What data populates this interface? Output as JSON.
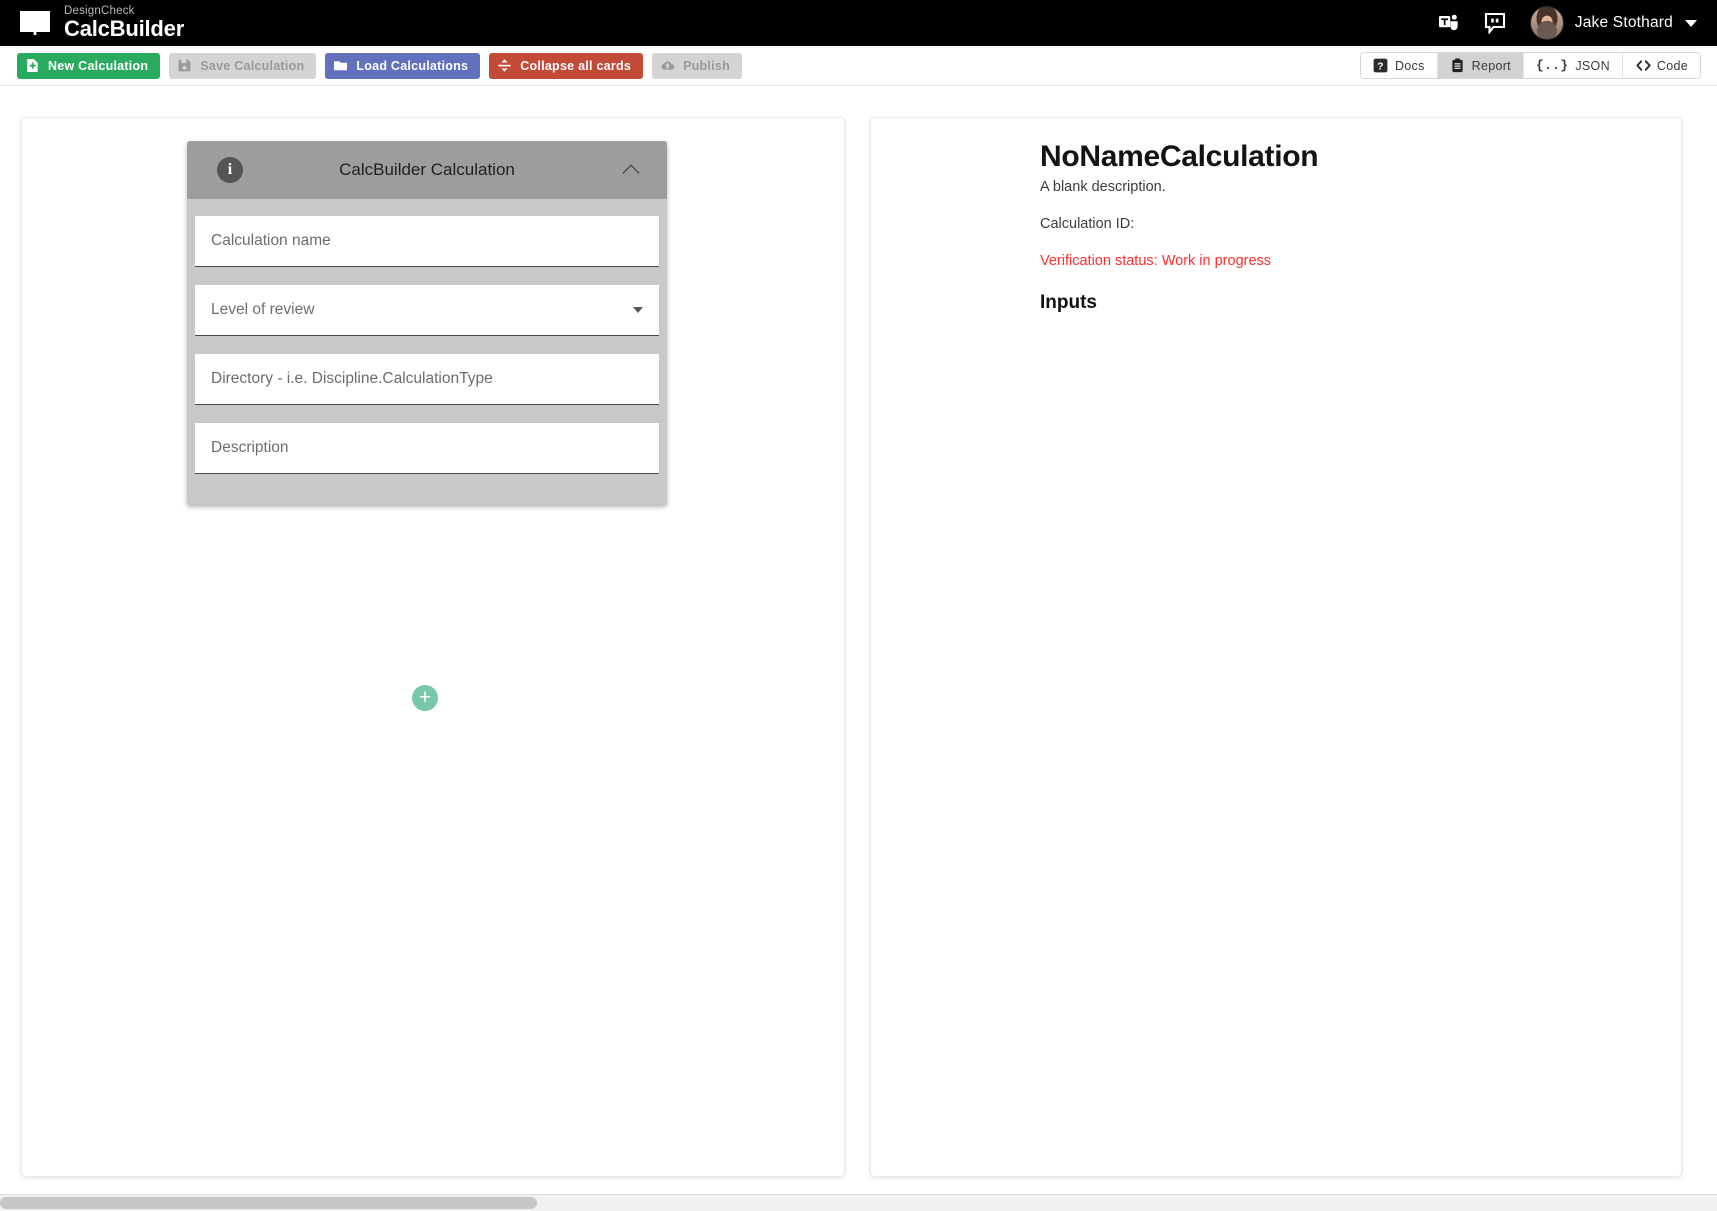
{
  "topbar": {
    "brand_sub": "DesignCheck",
    "brand_main": "CalcBuilder",
    "book_icon": "open-book-icon",
    "teams_icon": "microsoft-teams-icon",
    "feedback_icon": "feedback-quote-icon",
    "avatar": "user-avatar",
    "user_name": "Jake Stothard",
    "caret": "chevron-down-icon"
  },
  "toolbar": {
    "new_calculation": "New Calculation",
    "save_calculation": "Save Calculation",
    "load_calculations": "Load Calculations",
    "collapse_all": "Collapse all cards",
    "publish": "Publish",
    "docs": "Docs",
    "report": "Report",
    "json": "JSON",
    "json_glyph": "{..}",
    "code": "Code",
    "code_glyph": "< >",
    "colors": {
      "green": "#28ab5f",
      "blue": "#6271bd",
      "red": "#c24a36",
      "disabled": "#d4d4d4",
      "active_segment": "#d2d2d2"
    }
  },
  "card": {
    "info_icon": "info-icon",
    "title": "CalcBuilder Calculation",
    "collapse_icon": "chevron-up-icon",
    "fields": [
      {
        "name": "calculation-name",
        "placeholder": "Calculation name",
        "value": "",
        "type": "text"
      },
      {
        "name": "level-of-review",
        "placeholder": "Level of review",
        "value": "",
        "type": "select"
      },
      {
        "name": "directory",
        "placeholder": "Directory - i.e. Discipline.CalculationType",
        "value": "",
        "type": "text"
      },
      {
        "name": "description",
        "placeholder": "Description",
        "value": "",
        "type": "text"
      }
    ],
    "add_card_label": "+"
  },
  "report": {
    "title": "NoNameCalculation",
    "description": "A blank description.",
    "calculation_id": "Calculation ID:",
    "verification_status": "Verification status: Work in progress",
    "status_color": "#ff2f2f",
    "inputs_heading": "Inputs"
  }
}
